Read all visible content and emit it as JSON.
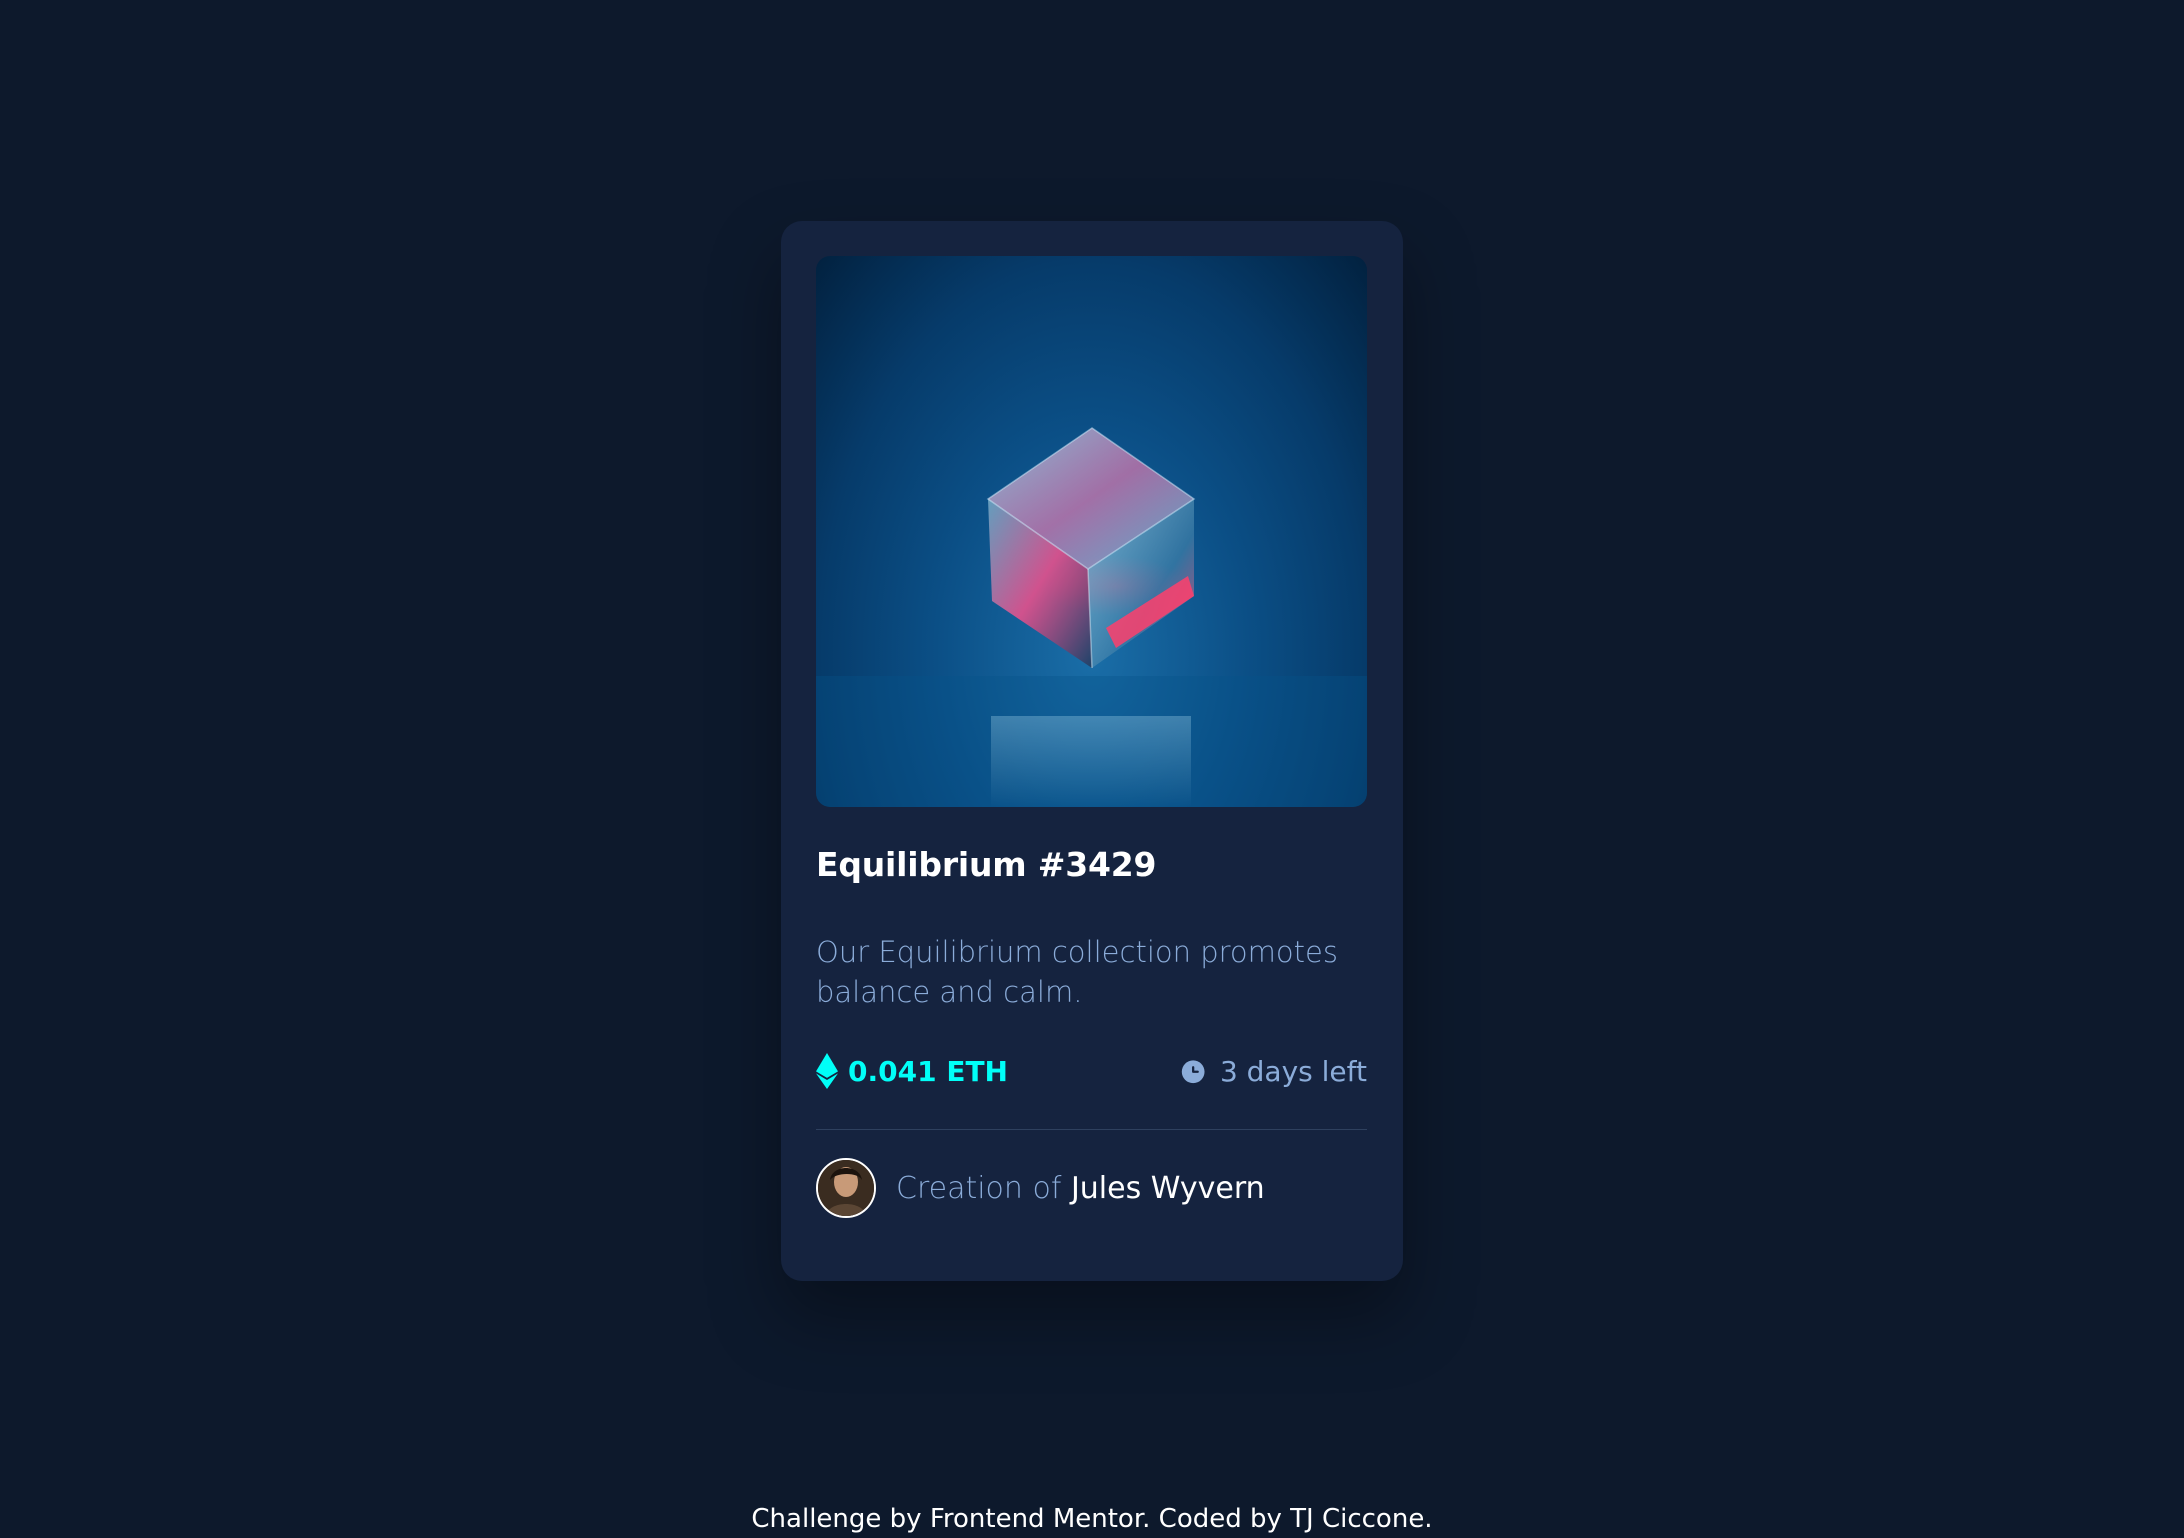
{
  "card": {
    "title": "Equilibrium #3429",
    "description": "Our Equilibrium collection promotes balance and calm.",
    "price": "0.041 ETH",
    "price_icon": "ethereum-icon",
    "time_left": "3 days left",
    "time_icon": "clock-icon",
    "creator_prefix": "Creation of",
    "creator_name": "Jules Wyvern"
  },
  "footer": {
    "text": "Challenge by Frontend Mentor. Coded by TJ Ciccone."
  },
  "colors": {
    "page_bg": "#0d192c",
    "card_bg": "#15233f",
    "accent_cyan": "#00fff8",
    "soft_blue": "#8bacd9",
    "divider": "#2e405e"
  }
}
